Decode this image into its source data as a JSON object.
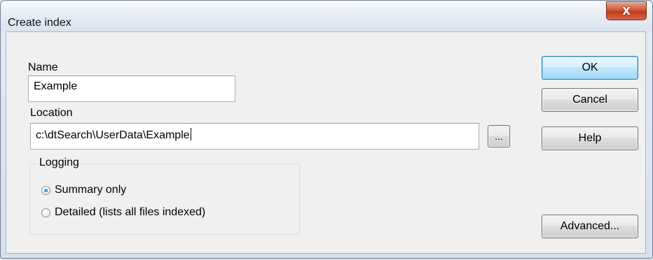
{
  "window": {
    "title": "Create index",
    "close_glyph": "X"
  },
  "form": {
    "name_label": "Name",
    "name_value": "Example",
    "location_label": "Location",
    "location_value": "c:\\dtSearch\\UserData\\Example",
    "browse_label": "..."
  },
  "logging": {
    "title": "Logging",
    "options": [
      {
        "label": "Summary only",
        "checked": true
      },
      {
        "label": "Detailed (lists all files indexed)",
        "checked": false
      }
    ]
  },
  "buttons": {
    "ok": "OK",
    "cancel": "Cancel",
    "help": "Help",
    "advanced": "Advanced..."
  },
  "colors": {
    "close_button": "#c8452a",
    "default_button_border": "#3c7fb1",
    "client_background": "#f0f0f0"
  }
}
